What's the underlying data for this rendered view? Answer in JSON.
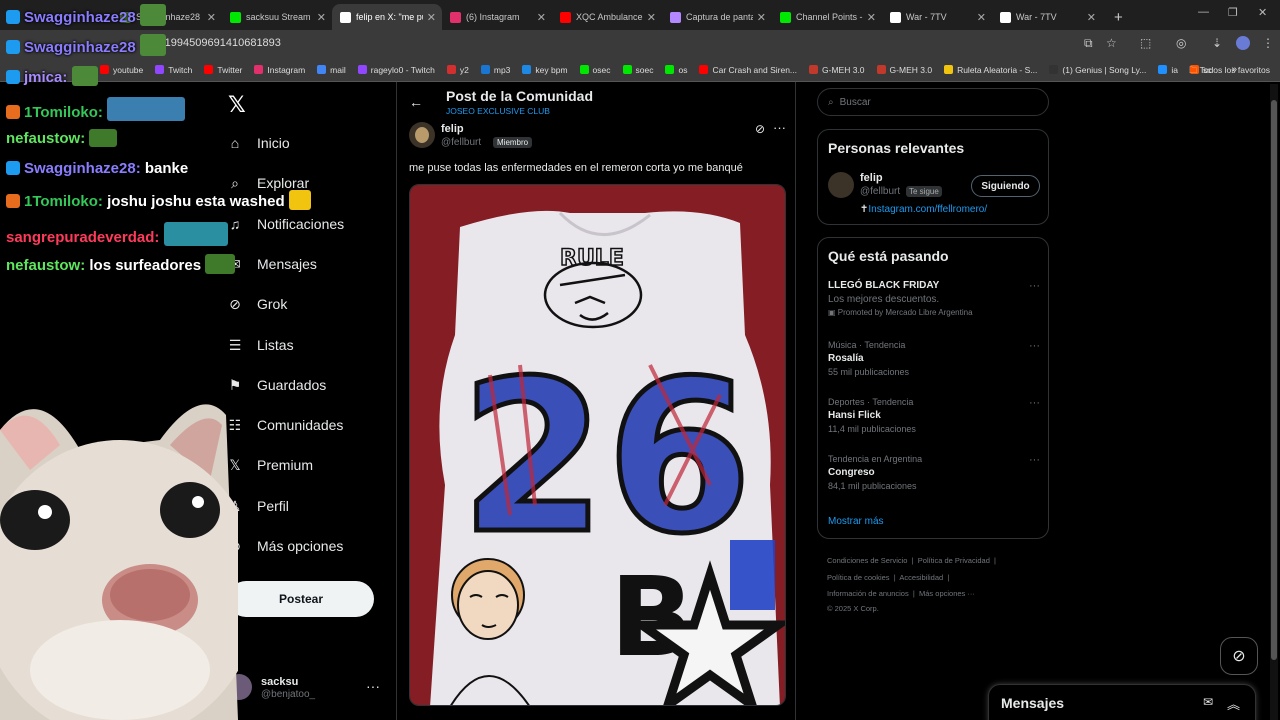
{
  "browser": {
    "tabs": [
      {
        "title": "Swagginhaze28",
        "icon_color": "#5b9b3a",
        "active": false
      },
      {
        "title": "sacksuu Stream -",
        "icon_color": "#00e701",
        "active": false
      },
      {
        "title": "felip en X: \"me pu",
        "icon_color": "#ffffff",
        "active": true
      },
      {
        "title": "(6) Instagram",
        "icon_color": "#e1306c",
        "active": false
      },
      {
        "title": "XQC Ambulance",
        "icon_color": "#ff0000",
        "active": false
      },
      {
        "title": "Captura de panta",
        "icon_color": "#b388ff",
        "active": false
      },
      {
        "title": "Channel Points - I",
        "icon_color": "#00e701",
        "active": false
      },
      {
        "title": "War - 7TV",
        "icon_color": "#ffffff",
        "active": false
      },
      {
        "title": "War - 7TV",
        "icon_color": "#ffffff",
        "active": false
      }
    ],
    "url": "us/1994509691410681893",
    "bookmarks": [
      {
        "label": "youtube",
        "color": "#ff0000"
      },
      {
        "label": "Twitch",
        "color": "#9146ff"
      },
      {
        "label": "Twitter",
        "color": "#ff0000"
      },
      {
        "label": "Instagram",
        "color": "#e1306c"
      },
      {
        "label": "mail",
        "color": "#4285f4"
      },
      {
        "label": "rageylo0 - Twitch",
        "color": "#9146ff"
      },
      {
        "label": "y2",
        "color": "#d32f2f"
      },
      {
        "label": "mp3",
        "color": "#1976d2"
      },
      {
        "label": "key bpm",
        "color": "#1e88e5"
      },
      {
        "label": "osec",
        "color": "#00e701"
      },
      {
        "label": "soec",
        "color": "#00e701"
      },
      {
        "label": "os",
        "color": "#00e701"
      },
      {
        "label": "Car Crash and Siren...",
        "color": "#ff0000"
      },
      {
        "label": "G-MEH 3.0",
        "color": "#c0392b"
      },
      {
        "label": "G-MEH 3.0",
        "color": "#c0392b"
      },
      {
        "label": "Ruleta Aleatoria - S...",
        "color": "#f1c40f"
      },
      {
        "label": "(1) Genius | Song Ly...",
        "color": "#333333"
      },
      {
        "label": "ia",
        "color": "#1e90ff"
      },
      {
        "label": "sc",
        "color": "#ff5500"
      }
    ],
    "all_bookmarks": "Todos los favoritos"
  },
  "nav": {
    "items": [
      {
        "label": "Inicio",
        "icon": "home-icon"
      },
      {
        "label": "Explorar",
        "icon": "search-icon"
      },
      {
        "label": "Notificaciones",
        "icon": "bell-icon"
      },
      {
        "label": "Mensajes",
        "icon": "mail-icon"
      },
      {
        "label": "Grok",
        "icon": "grok-icon"
      },
      {
        "label": "Listas",
        "icon": "list-icon"
      },
      {
        "label": "Guardados",
        "icon": "bookmark-icon"
      },
      {
        "label": "Comunidades",
        "icon": "people-icon"
      },
      {
        "label": "Premium",
        "icon": "x-icon"
      },
      {
        "label": "Perfil",
        "icon": "person-icon"
      },
      {
        "label": "Más opciones",
        "icon": "more-circle-icon"
      }
    ],
    "post_button": "Postear",
    "me": {
      "name": "sacksu",
      "handle": "@benjatoo_"
    }
  },
  "main": {
    "title": "Post de la Comunidad",
    "subtitle": "JOSEO EXCLUSIVE CLUB",
    "author": {
      "name": "felip",
      "handle": "@fellburt",
      "badge": "Miembro"
    },
    "text": "me puse todas las enfermedades en el remeron corta yo me banqué"
  },
  "right": {
    "search_placeholder": "Buscar",
    "relevant": {
      "heading": "Personas relevantes",
      "name": "felip",
      "handle": "@fellburt",
      "badge": "Te sigue",
      "follow_label": "Siguiendo",
      "link": "Instagram.com/ffellromero/"
    },
    "trending": {
      "heading": "Qué está pasando",
      "items": [
        {
          "category": "",
          "title": "LLEGÓ BLACK FRIDAY",
          "count": "Los mejores descuentos.",
          "promo": "Promoted by Mercado Libre Argentina"
        },
        {
          "category": "Música · Tendencia",
          "title": "Rosalía",
          "count": "55 mil publicaciones",
          "promo": ""
        },
        {
          "category": "Deportes · Tendencia",
          "title": "Hansi Flick",
          "count": "11,4 mil publicaciones",
          "promo": ""
        },
        {
          "category": "Tendencia en Argentina",
          "title": "Congreso",
          "count": "84,1 mil publicaciones",
          "promo": ""
        }
      ],
      "show_more": "Mostrar más"
    },
    "footer": {
      "line1": [
        "Condiciones de Servicio",
        "Política de Privacidad"
      ],
      "line2": [
        "Política de cookies",
        "Accesibilidad"
      ],
      "line3": [
        "Información de anuncios",
        "Más opciones ···"
      ],
      "copyright": "© 2025 X Corp."
    }
  },
  "dm": {
    "title": "Mensajes"
  },
  "chat": [
    {
      "user": "Swagginhaze28",
      "color": "#8a7dff",
      "badge": "#1d9bf0",
      "sep": "",
      "msg": ""
    },
    {
      "user": "Swagginhaze28",
      "color": "#8a7dff",
      "badge": "#1d9bf0",
      "sep": "",
      "msg": ""
    },
    {
      "user": "jmica",
      "color": "#a78bff",
      "badge": "#1d9bf0",
      "sep": ":",
      "msg": ""
    },
    {
      "user": "1Tomiloko",
      "color": "#34c759",
      "badge": "#e86c1d",
      "sep": ":",
      "msg": ""
    },
    {
      "user": "nefaustow",
      "color": "#5ee65e",
      "badge": "",
      "sep": ":",
      "msg": ""
    },
    {
      "user": "Swagginhaze28",
      "color": "#8a7dff",
      "badge": "#1d9bf0",
      "sep": ":",
      "msg": "banke"
    },
    {
      "user": "1Tomiloko",
      "color": "#34c759",
      "badge": "#e86c1d",
      "sep": ":",
      "msg": "joshu joshu esta washed"
    },
    {
      "user": "sangrepuradeverdad",
      "color": "#ff3b5c",
      "badge": "",
      "sep": ":",
      "msg": ""
    },
    {
      "user": "nefaustow",
      "color": "#5ee65e",
      "badge": "",
      "sep": ":",
      "msg": "los surfeadores"
    }
  ],
  "media": {
    "shirt_number": "26",
    "top_text": "RULE",
    "bottom_text": "B"
  }
}
